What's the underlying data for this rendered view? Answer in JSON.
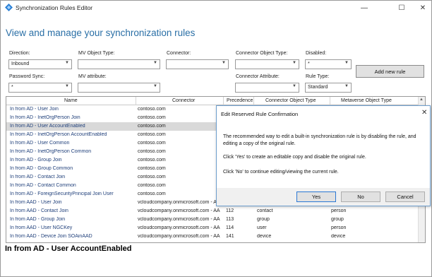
{
  "window": {
    "title": "Synchronization Rules Editor",
    "controls": [
      "—",
      "☐",
      "✕"
    ]
  },
  "heading": "View and manage your synchronization rules",
  "filters": {
    "direction": {
      "label": "Direction:",
      "value": "Inbound"
    },
    "mv_object_type": {
      "label": "MV Object Type:",
      "value": ""
    },
    "connector": {
      "label": "Connector:",
      "value": ""
    },
    "connector_object_type": {
      "label": "Connector Object Type:",
      "value": ""
    },
    "disabled": {
      "label": "Disabled:",
      "value": "*"
    },
    "password_sync": {
      "label": "Password Sync:",
      "value": "*"
    },
    "mv_attribute": {
      "label": "MV attribute:",
      "value": ""
    },
    "connector_attribute": {
      "label": "Connector Attribute:",
      "value": ""
    },
    "rule_type": {
      "label": "Rule Type:",
      "value": "Standard"
    }
  },
  "add_new_rule_label": "Add new rule",
  "grid": {
    "columns": [
      "Name",
      "Connector",
      "Precedence",
      "Connector Object Type",
      "Metaverse Object Type"
    ],
    "rows": [
      {
        "name": "In from AD - User Join",
        "connector": "contoso.com",
        "precedence": "",
        "cot": "",
        "mvot": ""
      },
      {
        "name": "In from AD - InetOrgPerson Join",
        "connector": "contoso.com",
        "precedence": "",
        "cot": "",
        "mvot": ""
      },
      {
        "name": "In from AD - User AccountEnabled",
        "connector": "contoso.com",
        "precedence": "",
        "cot": "",
        "mvot": "",
        "selected": true
      },
      {
        "name": "In from AD - InetOrgPerson AccountEnabled",
        "connector": "contoso.com",
        "precedence": "",
        "cot": "",
        "mvot": ""
      },
      {
        "name": "In from AD - User Common",
        "connector": "contoso.com",
        "precedence": "",
        "cot": "",
        "mvot": ""
      },
      {
        "name": "In from AD - InetOrgPerson Common",
        "connector": "contoso.com",
        "precedence": "",
        "cot": "",
        "mvot": ""
      },
      {
        "name": "In from AD - Group Join",
        "connector": "contoso.com",
        "precedence": "",
        "cot": "",
        "mvot": ""
      },
      {
        "name": "In from AD - Group Common",
        "connector": "contoso.com",
        "precedence": "",
        "cot": "",
        "mvot": ""
      },
      {
        "name": "In from AD - Contact Join",
        "connector": "contoso.com",
        "precedence": "",
        "cot": "",
        "mvot": ""
      },
      {
        "name": "In from AD - Contact Common",
        "connector": "contoso.com",
        "precedence": "",
        "cot": "",
        "mvot": ""
      },
      {
        "name": "In from AD - ForeignSecurityPrincipal Join User",
        "connector": "contoso.com",
        "precedence": "",
        "cot": "",
        "mvot": ""
      },
      {
        "name": "In from AAD - User Join",
        "connector": "vcloudcompany.onmicrosoft.com - AA",
        "precedence": "",
        "cot": "",
        "mvot": ""
      },
      {
        "name": "In from AAD - Contact Join",
        "connector": "vcloudcompany.onmicrosoft.com - AA",
        "precedence": "112",
        "cot": "contact",
        "mvot": "person"
      },
      {
        "name": "In from AAD - Group Join",
        "connector": "vcloudcompany.onmicrosoft.com - AA",
        "precedence": "113",
        "cot": "group",
        "mvot": "group"
      },
      {
        "name": "In from AAD - User NGCKey",
        "connector": "vcloudcompany.onmicrosoft.com - AA",
        "precedence": "114",
        "cot": "user",
        "mvot": "person"
      },
      {
        "name": "In from AAD - Device Join SOAinAAD",
        "connector": "vcloudcompany.onmicrosoft.com - AA",
        "precedence": "141",
        "cot": "device",
        "mvot": "device"
      }
    ]
  },
  "status_text": "In from AD - User AccountEnabled",
  "dialog": {
    "title": "Edit Reserved Rule Confirmation",
    "para1": "The recommended way to edit a built-in synchronization rule is by disabling the rule, and editing a copy of the original rule.",
    "para2": "Click 'Yes' to create an editable copy and disable the original rule.",
    "para3": "Click 'No' to continue editing/viewing the current rule.",
    "yes_label": "Yes",
    "no_label": "No",
    "cancel_label": "Cancel"
  },
  "colors": {
    "heading": "#2a6fa6",
    "link_text": "#1f3f7a",
    "selected_row": "#d9d9d9",
    "dialog_border": "#6e9fce"
  }
}
